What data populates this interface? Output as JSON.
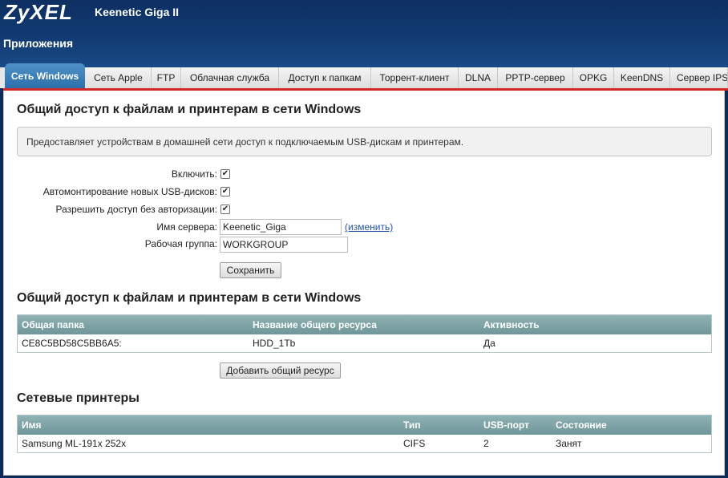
{
  "header": {
    "logo": "ZyXEL",
    "model": "Keenetic Giga II",
    "section": "Приложения"
  },
  "tabs": [
    {
      "label": "Сеть Windows",
      "active": true
    },
    {
      "label": "Сеть Apple"
    },
    {
      "label": "FTP"
    },
    {
      "label": "Облачная служба"
    },
    {
      "label": "Доступ к папкам"
    },
    {
      "label": "Торрент-клиент"
    },
    {
      "label": "DLNA"
    },
    {
      "label": "PPTP-сервер"
    },
    {
      "label": "OPKG"
    },
    {
      "label": "KeenDNS"
    },
    {
      "label": "Сервер IPSec"
    }
  ],
  "main": {
    "title1": "Общий доступ к файлам и принтерам в сети Windows",
    "info": "Предоставляет устройствам в домашней сети доступ к подключаемым USB-дискам и принтерам.",
    "form": {
      "enable_label": "Включить:",
      "automount_label": "Автомонтирование новых USB-дисков:",
      "anon_label": "Разрешить доступ без авторизации:",
      "server_name_label": "Имя сервера:",
      "server_name_value": "Keenetic_Giga",
      "change_link": "(изменить)",
      "workgroup_label": "Рабочая группа:",
      "workgroup_value": "WORKGROUP",
      "save_label": "Сохранить",
      "check_mark": "✔"
    },
    "title2": "Общий доступ к файлам и принтерам в сети Windows",
    "shares": {
      "headers": [
        "Общая папка",
        "Название общего ресурса",
        "Активность"
      ],
      "rows": [
        [
          "CE8C5BD58C5BB6A5:",
          "HDD_1Tb",
          "Да"
        ]
      ],
      "add_label": "Добавить общий ресурс"
    },
    "title3": "Сетевые принтеры",
    "printers": {
      "headers": [
        "Имя",
        "Тип",
        "USB-порт",
        "Состояние"
      ],
      "rows": [
        [
          "Samsung ML-191x 252x",
          "CIFS",
          "2",
          "Занят"
        ]
      ]
    }
  }
}
